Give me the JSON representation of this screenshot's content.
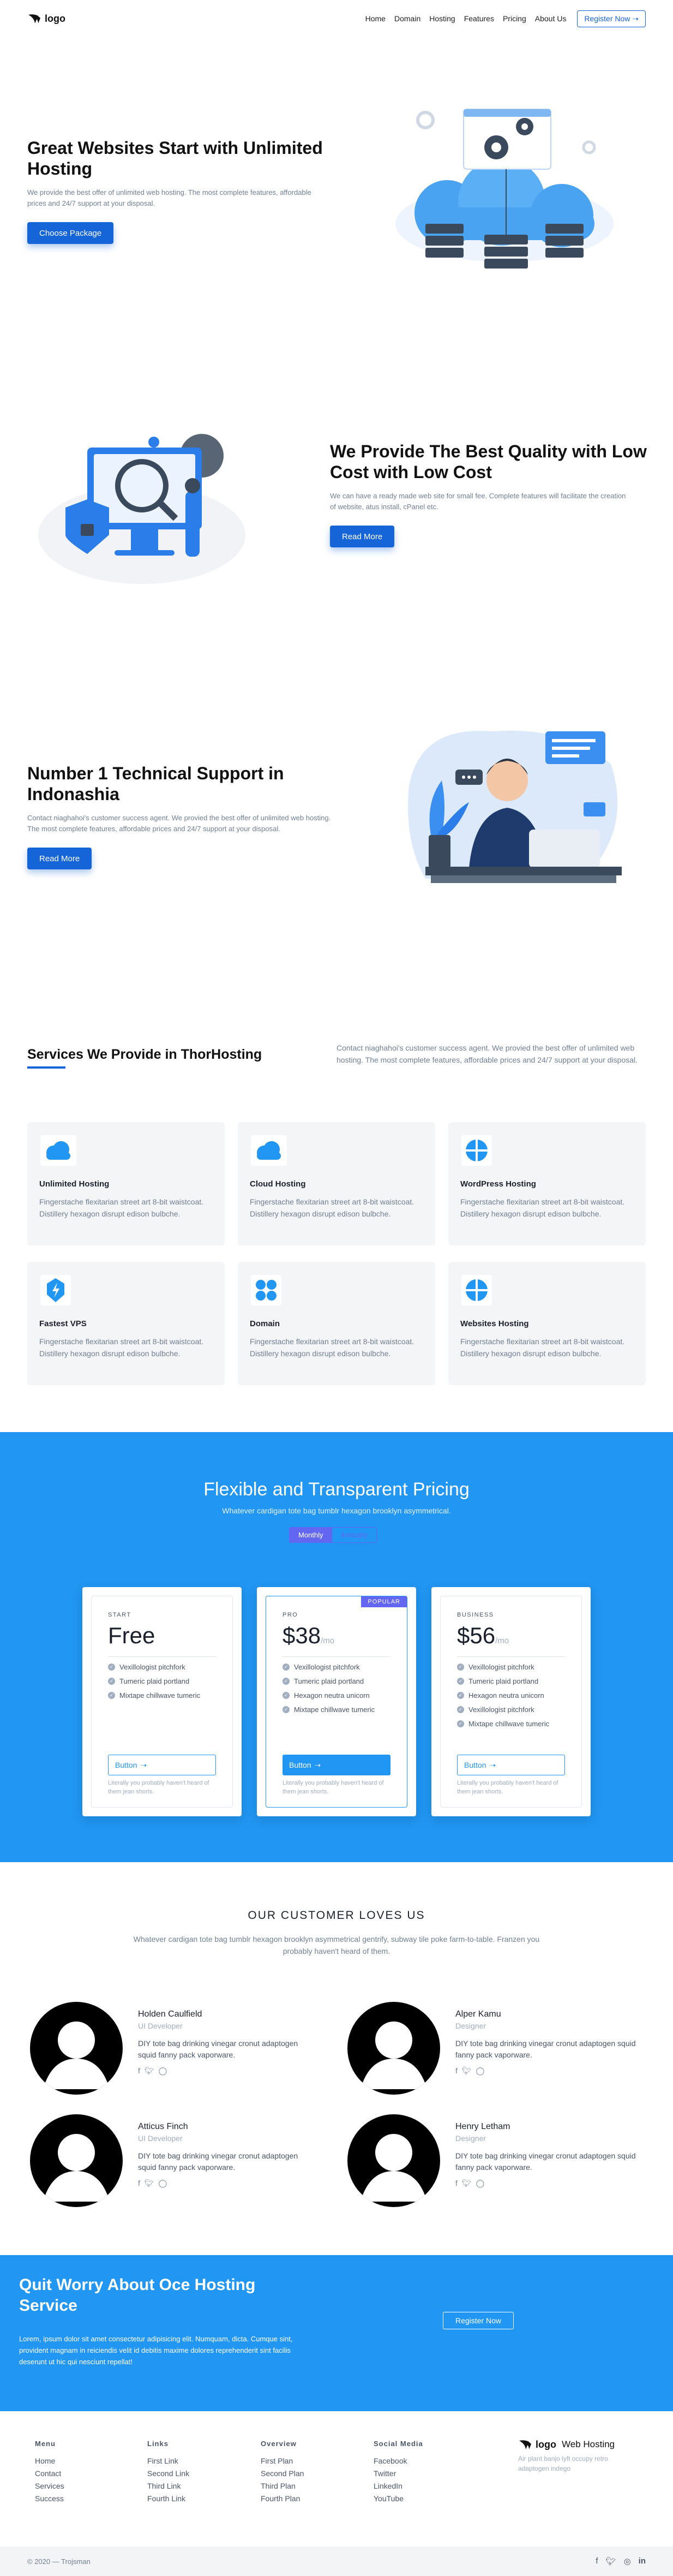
{
  "nav": {
    "logo": "logo",
    "links": [
      "Home",
      "Domain",
      "Hosting",
      "Features",
      "Pricing",
      "About Us"
    ],
    "register": "Register Now"
  },
  "hero1": {
    "title": "Great Websites Start with Unlimited Hosting",
    "text": "We provide the best offer of unlimited web hosting. The most complete features, affordable prices and 24/7 support at your disposal.",
    "button": "Choose Package",
    "illustration_label": "cloud-hosting-illustration"
  },
  "hero2": {
    "title": "We Provide The Best Quality with Low Cost with Low Cost",
    "text": "We can have a ready made web site for small fee. Complete features will facilitate the creation of website, atus install, cPanel etc.",
    "button": "Read More",
    "illustration_label": "security-illustration"
  },
  "hero3": {
    "title": "Number 1 Technical Support in Indonashia",
    "text": "Contact niaghahoi's customer success agent. We provied the best offer of unlimited web hosting. The most complete features, affordable prices and 24/7 support at your disposal.",
    "button": "Read More",
    "illustration_label": "support-illustration"
  },
  "services": {
    "title": "Services We Provide in ThorHosting",
    "intro": "Contact niaghahoi's customer success agent. We provied the best offer of unlimited web hosting. The most complete features, affordable prices and 24/7 support at your disposal.",
    "items": [
      {
        "title": "Unlimited Hosting",
        "desc": "Fingerstache flexitarian street art 8-bit waistcoat. Distillery hexagon disrupt edison bulbche.",
        "icon": "cloud-icon"
      },
      {
        "title": "Cloud Hosting",
        "desc": "Fingerstache flexitarian street art 8-bit waistcoat. Distillery hexagon disrupt edison bulbche.",
        "icon": "cloud-icon"
      },
      {
        "title": "WordPress Hosting",
        "desc": "Fingerstache flexitarian street art 8-bit waistcoat. Distillery hexagon disrupt edison bulbche.",
        "icon": "grid-circle-icon"
      },
      {
        "title": "Fastest VPS",
        "desc": "Fingerstache flexitarian street art 8-bit waistcoat. Distillery hexagon disrupt edison bulbche.",
        "icon": "lightning-icon"
      },
      {
        "title": "Domain",
        "desc": "Fingerstache flexitarian street art 8-bit waistcoat. Distillery hexagon disrupt edison bulbche.",
        "icon": "dots-icon"
      },
      {
        "title": "Websites Hosting",
        "desc": "Fingerstache flexitarian street art 8-bit waistcoat. Distillery hexagon disrupt edison bulbche.",
        "icon": "grid-circle-icon"
      }
    ]
  },
  "pricing": {
    "title": "Flexible and Transparent Pricing",
    "subtitle": "Whatever cardigan tote bag tumblr hexagon brooklyn asymmetrical.",
    "toggle": [
      "Monthly",
      "Annually"
    ],
    "plans": [
      {
        "name": "START",
        "price": "Free",
        "per": "",
        "features": [
          "Vexillologist pitchfork",
          "Tumeric plaid portland",
          "Mixtape chillwave tumeric"
        ],
        "button": "Button",
        "note": "Literally you probably haven't heard of them jean shorts.",
        "badge": ""
      },
      {
        "name": "PRO",
        "price": "$38",
        "per": "/mo",
        "features": [
          "Vexillologist pitchfork",
          "Tumeric plaid portland",
          "Hexagon neutra unicorn",
          "Mixtape chillwave tumeric"
        ],
        "button": "Button",
        "note": "Literally you probably haven't heard of them jean shorts.",
        "badge": "POPULAR"
      },
      {
        "name": "BUSINESS",
        "price": "$56",
        "per": "/mo",
        "features": [
          "Vexillologist pitchfork",
          "Tumeric plaid portland",
          "Hexagon neutra unicorn",
          "Vexillologist pitchfork",
          "Mixtape chillwave tumeric"
        ],
        "button": "Button",
        "note": "Literally you probably haven't heard of them jean shorts.",
        "badge": ""
      }
    ]
  },
  "testimonials": {
    "title": "OUR CUSTOMER LOVES US",
    "subtitle": "Whatever cardigan tote bag tumblr hexagon brooklyn asymmetrical gentrify, subway tile poke farm-to-table. Franzen you probably haven't heard of them.",
    "items": [
      {
        "name": "Holden Caulfield",
        "role": "UI Developer",
        "text": "DIY tote bag drinking vinegar cronut adaptogen squid fanny pack vaporware."
      },
      {
        "name": "Alper Kamu",
        "role": "Designer",
        "text": "DIY tote bag drinking vinegar cronut adaptogen squid fanny pack vaporware."
      },
      {
        "name": "Atticus Finch",
        "role": "UI Developer",
        "text": "DIY tote bag drinking vinegar cronut adaptogen squid fanny pack vaporware."
      },
      {
        "name": "Henry Letham",
        "role": "Designer",
        "text": "DIY tote bag drinking vinegar cronut adaptogen squid fanny pack vaporware."
      }
    ]
  },
  "cta": {
    "title": "Quit Worry About Oce Hosting Service",
    "text": "Lorem, ipsum dolor sit amet consectetur adipisicing elit. Numquam, dicta. Cumque sint, provident magnam in reiciendis velit id debitis maxime dolores reprehenderit sint facilis deserunt ut hic qui nesciunt repellat!",
    "button": "Register Now"
  },
  "footer": {
    "columns": [
      {
        "title": "Menu",
        "links": [
          "Home",
          "Contact",
          "Services",
          "Success"
        ]
      },
      {
        "title": "Links",
        "links": [
          "First Link",
          "Second Link",
          "Third Link",
          "Fourth Link"
        ]
      },
      {
        "title": "Overview",
        "links": [
          "First Plan",
          "Second Plan",
          "Third Plan",
          "Fourth Plan"
        ]
      },
      {
        "title": "Social Media",
        "links": [
          "Facebook",
          "Twitter",
          "LinkedIn",
          "YouTube"
        ]
      }
    ],
    "brand_logo": "logo",
    "brand_name": "Web Hosting",
    "brand_text": "Air plant banjo lyft occupy retro adaptogen indego",
    "copyright": "© 2020 — Trojsman"
  },
  "colors": {
    "primary": "#1565d8",
    "pricing_bg": "#2196f3",
    "accent_badge": "#6366f1"
  }
}
